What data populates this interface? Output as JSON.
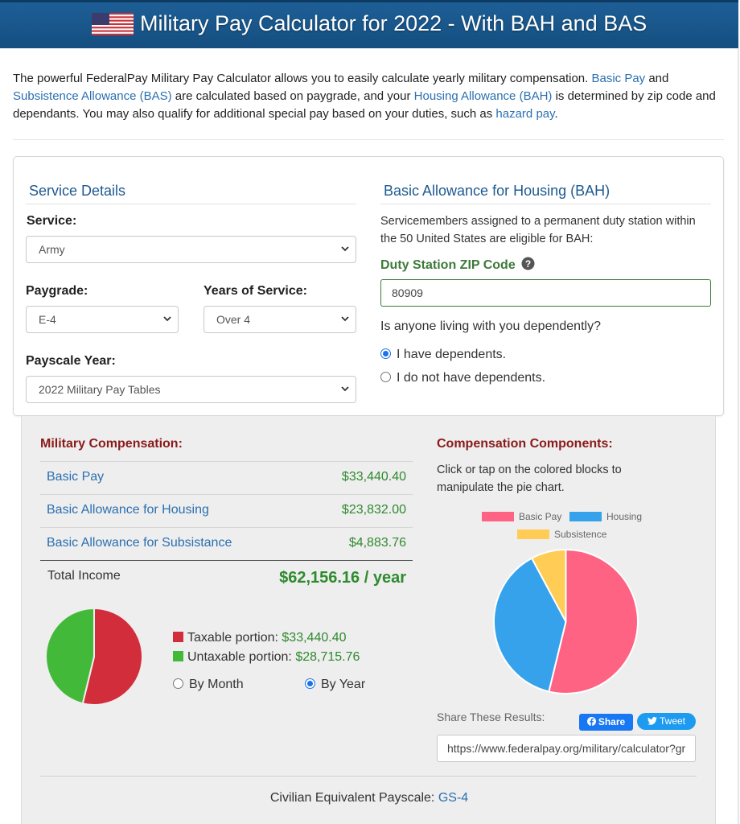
{
  "header": {
    "title": "Military Pay Calculator for 2022 - With BAH and BAS"
  },
  "intro": {
    "t1": "The powerful FederalPay Military Pay Calculator allows you to easily calculate yearly military compensation. ",
    "link_basic_pay": "Basic Pay",
    "t2": " and ",
    "link_bas": "Subsistence Allowance (BAS)",
    "t3": " are calculated based on paygrade, and your ",
    "link_bah": "Housing Allowance (BAH)",
    "t4": " is determined by zip code and dependants. You may also qualify for additional special pay based on your duties, such as ",
    "link_hazard": "hazard pay",
    "t5": "."
  },
  "service_details": {
    "title": "Service Details",
    "service_label": "Service:",
    "service_value": "Army",
    "paygrade_label": "Paygrade:",
    "paygrade_value": "E-4",
    "years_label": "Years of Service:",
    "years_value": "Over 4",
    "payscale_label": "Payscale Year:",
    "payscale_value": "2022 Military Pay Tables"
  },
  "bah": {
    "title": "Basic Allowance for Housing (BAH)",
    "description": "Servicemembers assigned to a permanent duty station within the 50 United States are eligible for BAH:",
    "zip_label": "Duty Station ZIP Code",
    "zip_value": "80909",
    "question": "Is anyone living with you dependently?",
    "option_yes": "I have dependents.",
    "option_no": "I do not have dependents.",
    "selected": "yes"
  },
  "compensation": {
    "title": "Military Compensation:",
    "rows": [
      {
        "label": "Basic Pay",
        "value": "$33,440.40"
      },
      {
        "label": "Basic Allowance for Housing",
        "value": "$23,832.00"
      },
      {
        "label": "Basic Allowance for Subsistance",
        "value": "$4,883.76"
      }
    ],
    "total_label": "Total Income",
    "total_value": "$62,156.16 / year",
    "taxable_label": "Taxable portion: ",
    "taxable_value": "$33,440.40",
    "untaxable_label": "Untaxable portion: ",
    "untaxable_value": "$28,715.76",
    "by_month": "By Month",
    "by_year": "By Year",
    "period_selected": "year",
    "colors": {
      "taxable": "#d22d3a",
      "untaxable": "#43b93a"
    }
  },
  "components": {
    "title": "Compensation Components:",
    "description": "Click or tap on the colored blocks to manipulate the pie chart.",
    "legend": [
      {
        "label": "Basic Pay",
        "color": "#ff6384"
      },
      {
        "label": "Housing",
        "color": "#36a2eb"
      },
      {
        "label": "Subsistence",
        "color": "#ffcd56"
      }
    ],
    "share_label": "Share These Results:",
    "share_button": "Share",
    "tweet_button": "Tweet",
    "url_value": "https://www.federalpay.org/military/calculator?gr"
  },
  "civilian": {
    "label": "Civilian Equivalent Payscale: ",
    "link": "GS-4"
  },
  "chart_data": [
    {
      "type": "pie",
      "categories": [
        "Taxable portion",
        "Untaxable portion"
      ],
      "values": [
        33440.4,
        28715.76
      ],
      "colors": [
        "#d22d3a",
        "#43b93a"
      ]
    },
    {
      "type": "pie",
      "categories": [
        "Basic Pay",
        "Housing",
        "Subsistence"
      ],
      "values": [
        33440.4,
        23832.0,
        4883.76
      ],
      "colors": [
        "#ff6384",
        "#36a2eb",
        "#ffcd56"
      ]
    }
  ]
}
